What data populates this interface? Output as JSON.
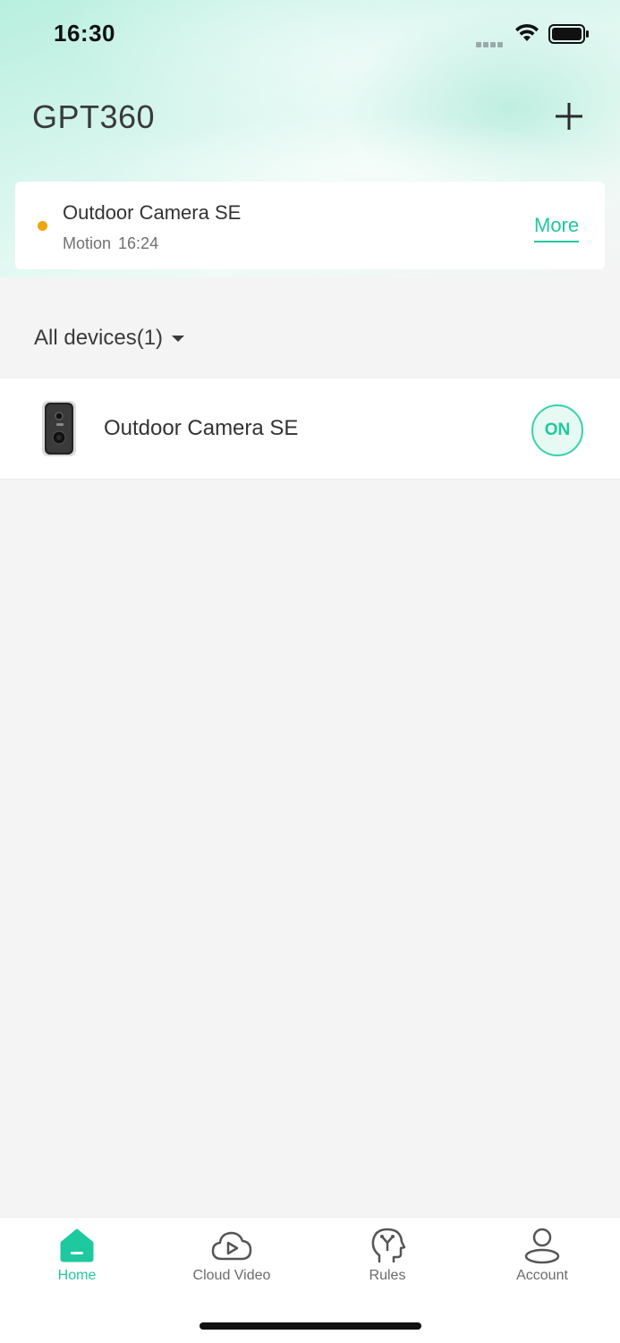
{
  "status_bar": {
    "time": "16:30",
    "icons": [
      "cellular-icon",
      "wifi-icon",
      "battery-icon"
    ]
  },
  "header": {
    "title": "GPT360",
    "add_icon": "plus-icon"
  },
  "event": {
    "device": "Outdoor Camera SE",
    "type": "Motion",
    "time": "16:24",
    "more_label": "More",
    "dot_color": "#f0a50c"
  },
  "filter": {
    "label": "All devices(1)"
  },
  "devices": [
    {
      "name": "Outdoor Camera SE",
      "status": "ON"
    }
  ],
  "tabs": [
    {
      "label": "Home",
      "icon": "home-icon",
      "active": true
    },
    {
      "label": "Cloud Video",
      "icon": "cloud-video-icon",
      "active": false
    },
    {
      "label": "Rules",
      "icon": "rules-icon",
      "active": false
    },
    {
      "label": "Account",
      "icon": "account-icon",
      "active": false
    }
  ],
  "colors": {
    "accent": "#1fc9a0",
    "event_dot": "#f0a50c"
  }
}
